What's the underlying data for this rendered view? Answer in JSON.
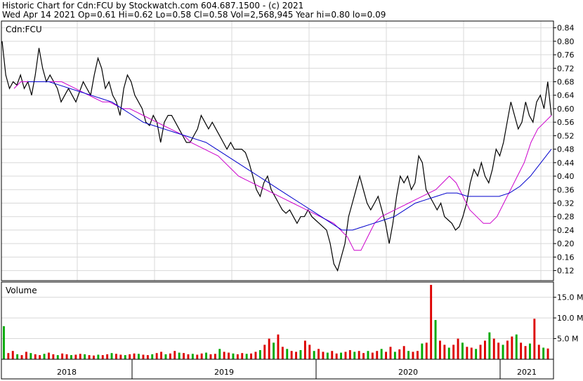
{
  "header": {
    "line1": "Historic Chart for Cdn:FCU by Stockwatch.com 604.687.1500 - (c) 2021",
    "line2": "Wed Apr 14 2021  Op=0.61  Hi=0.62  Lo=0.58  Cl=0.58  Vol=2,568,945  Year hi=0.80  lo=0.09"
  },
  "price_panel": {
    "label": "Cdn:FCU"
  },
  "volume_panel": {
    "label": "Volume"
  },
  "colors": {
    "price": "#000000",
    "ma_short": "#cc00cc",
    "ma_long": "#0000cc",
    "vol_up": "#00aa00",
    "vol_down": "#dd0000",
    "grid": "#d8d8d8",
    "frame": "#000000"
  },
  "chart_data": [
    {
      "type": "line",
      "title": "Cdn:FCU",
      "x_labels": [
        "2018",
        "2019",
        "2020",
        "2021"
      ],
      "ylim": [
        0.09,
        0.86
      ],
      "yticks": [
        "0.84",
        "0.80",
        "0.76",
        "0.72",
        "0.68",
        "0.64",
        "0.60",
        "0.56",
        "0.52",
        "0.48",
        "0.44",
        "0.40",
        "0.36",
        "0.32",
        "0.28",
        "0.24",
        "0.20",
        "0.16",
        "0.12"
      ],
      "grid": true,
      "series": [
        {
          "values": [
            0.8,
            0.7,
            0.66,
            0.68,
            0.67,
            0.7,
            0.66,
            0.68,
            0.64,
            0.7,
            0.78,
            0.72,
            0.68,
            0.7,
            0.68,
            0.66,
            0.62,
            0.64,
            0.66,
            0.64,
            0.62,
            0.65,
            0.68,
            0.66,
            0.64,
            0.7,
            0.75,
            0.72,
            0.66,
            0.68,
            0.64,
            0.62,
            0.58,
            0.66,
            0.7,
            0.68,
            0.64,
            0.62,
            0.6,
            0.56,
            0.55,
            0.58,
            0.56,
            0.5,
            0.56,
            0.58,
            0.58,
            0.56,
            0.54,
            0.52,
            0.5,
            0.5,
            0.52,
            0.54,
            0.58,
            0.56,
            0.54,
            0.56,
            0.54,
            0.52,
            0.5,
            0.48,
            0.5,
            0.48,
            0.48,
            0.48,
            0.47,
            0.44,
            0.4,
            0.36,
            0.34,
            0.38,
            0.4,
            0.36,
            0.34,
            0.32,
            0.3,
            0.29,
            0.3,
            0.28,
            0.26,
            0.28,
            0.28,
            0.3,
            0.28,
            0.27,
            0.26,
            0.25,
            0.24,
            0.2,
            0.14,
            0.12,
            0.16,
            0.2,
            0.28,
            0.32,
            0.36,
            0.4,
            0.36,
            0.32,
            0.3,
            0.32,
            0.34,
            0.3,
            0.26,
            0.2,
            0.26,
            0.34,
            0.4,
            0.38,
            0.4,
            0.36,
            0.38,
            0.46,
            0.44,
            0.36,
            0.34,
            0.32,
            0.3,
            0.32,
            0.28,
            0.27,
            0.26,
            0.24,
            0.25,
            0.28,
            0.32,
            0.38,
            0.42,
            0.4,
            0.44,
            0.4,
            0.38,
            0.42,
            0.48,
            0.46,
            0.5,
            0.56,
            0.62,
            0.58,
            0.54,
            0.56,
            0.62,
            0.58,
            0.56,
            0.62,
            0.64,
            0.6,
            0.68,
            0.58
          ]
        },
        {
          "name": "",
          "values": [
            0.66,
            0.68,
            0.68,
            0.68,
            0.68,
            0.68,
            0.68,
            0.68,
            0.67,
            0.66,
            0.65,
            0.64,
            0.63,
            0.62,
            0.62,
            0.61,
            0.6,
            0.6,
            0.59,
            0.58,
            0.57,
            0.56,
            0.55,
            0.54,
            0.53,
            0.52,
            0.5,
            0.49,
            0.48,
            0.47,
            0.46,
            0.44,
            0.42,
            0.4,
            0.39,
            0.38,
            0.37,
            0.36,
            0.35,
            0.34,
            0.33,
            0.32,
            0.31,
            0.3,
            0.29,
            0.28,
            0.27,
            0.26,
            0.24,
            0.22,
            0.18,
            0.18,
            0.22,
            0.26,
            0.28,
            0.29,
            0.3,
            0.31,
            0.32,
            0.33,
            0.34,
            0.35,
            0.36,
            0.38,
            0.4,
            0.38,
            0.34,
            0.3,
            0.28,
            0.26,
            0.26,
            0.28,
            0.32,
            0.36,
            0.4,
            0.44,
            0.5,
            0.54,
            0.56,
            0.58
          ]
        },
        {
          "name": "",
          "values": [
            0.68,
            0.68,
            0.68,
            0.67,
            0.66,
            0.65,
            0.64,
            0.63,
            0.62,
            0.6,
            0.58,
            0.56,
            0.55,
            0.54,
            0.53,
            0.52,
            0.51,
            0.5,
            0.48,
            0.46,
            0.44,
            0.42,
            0.4,
            0.38,
            0.36,
            0.34,
            0.32,
            0.3,
            0.28,
            0.26,
            0.24,
            0.24,
            0.25,
            0.26,
            0.27,
            0.28,
            0.3,
            0.32,
            0.33,
            0.34,
            0.35,
            0.35,
            0.34,
            0.34,
            0.34,
            0.34,
            0.35,
            0.37,
            0.4,
            0.44,
            0.48
          ]
        }
      ]
    },
    {
      "type": "bar",
      "title": "Volume",
      "yticks": [
        "15.0 M",
        "10.0 M",
        "5.0 M"
      ],
      "ylim": [
        0,
        18
      ],
      "values": [
        8.0,
        1.5,
        2.0,
        1.2,
        1.0,
        1.8,
        1.5,
        1.2,
        1.0,
        1.3,
        1.6,
        1.2,
        1.0,
        1.4,
        1.2,
        1.0,
        1.1,
        1.3,
        1.2,
        1.0,
        0.9,
        1.1,
        1.0,
        1.2,
        1.5,
        1.3,
        1.1,
        1.0,
        1.2,
        1.4,
        1.3,
        1.1,
        1.0,
        1.2,
        1.5,
        1.8,
        1.2,
        1.4,
        2.0,
        1.6,
        1.5,
        1.2,
        1.3,
        1.1,
        1.4,
        1.6,
        1.2,
        1.3,
        2.5,
        1.8,
        1.6,
        1.4,
        1.2,
        1.5,
        1.3,
        1.4,
        1.8,
        2.2,
        3.5,
        5.0,
        4.0,
        6.0,
        3.0,
        2.5,
        2.0,
        1.8,
        2.2,
        4.5,
        3.5,
        2.0,
        2.5,
        1.8,
        1.6,
        2.0,
        1.4,
        1.6,
        1.8,
        2.2,
        1.8,
        2.0,
        1.5,
        2.0,
        1.6,
        2.0,
        2.5,
        1.8,
        3.0,
        1.8,
        2.4,
        3.2,
        2.0,
        1.8,
        2.0,
        3.8,
        4.0,
        18.0,
        9.5,
        4.5,
        3.5,
        2.8,
        3.5,
        5.0,
        4.0,
        3.0,
        2.8,
        2.5,
        3.5,
        4.5,
        6.5,
        5.0,
        4.0,
        3.5,
        4.5,
        5.5,
        6.0,
        4.0,
        3.2,
        3.8,
        9.8,
        3.5,
        2.8,
        2.6
      ]
    }
  ]
}
